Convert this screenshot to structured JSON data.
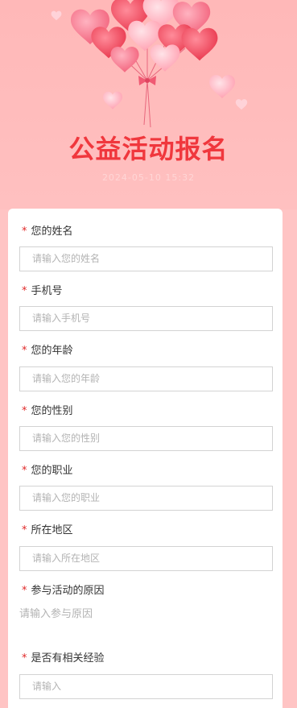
{
  "header": {
    "title": "公益活动报名",
    "date": "2024-05-10 15:32"
  },
  "colors": {
    "background": "#ffc4c4",
    "title": "#f0373d",
    "required": "#e02828",
    "heart_red": "#f04a5c",
    "heart_pink": "#ff9fae"
  },
  "form": {
    "required_mark": "*",
    "fields": [
      {
        "label": "您的姓名",
        "placeholder": "请输入您的姓名"
      },
      {
        "label": "手机号",
        "placeholder": "请输入手机号"
      },
      {
        "label": "您的年龄",
        "placeholder": "请输入您的年龄"
      },
      {
        "label": "您的性别",
        "placeholder": "请输入您的性别"
      },
      {
        "label": "您的职业",
        "placeholder": "请输入您的职业"
      },
      {
        "label": "所在地区",
        "placeholder": "请输入所在地区"
      },
      {
        "label": "参与活动的原因",
        "placeholder": "请输入参与原因"
      },
      {
        "label": "是否有相关经验",
        "placeholder": "请输入"
      }
    ]
  }
}
